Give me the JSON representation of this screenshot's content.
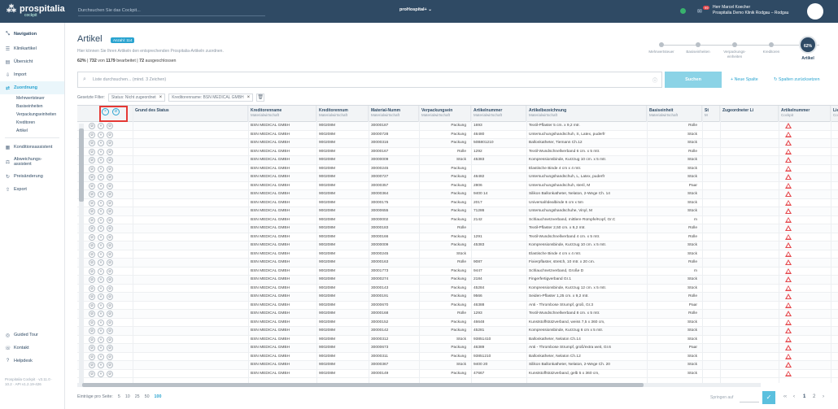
{
  "topbar": {
    "logo": "prospitalia",
    "logo_sub": "cockpit",
    "search_placeholder": "Durchsuchen Sie das Cockpit...",
    "tenant": "proHospital+ ⌄",
    "badge": "99",
    "user_name": "Herr Marcel Koecher",
    "user_org": "Prospitalia Demo Klinik Rodgau – Rodgau"
  },
  "sidebar": {
    "header": "Navigation",
    "items": [
      {
        "label": "Klinikartikel"
      },
      {
        "label": "Übersicht"
      },
      {
        "label": "Import"
      },
      {
        "label": "Zuordnung"
      }
    ],
    "subitems": [
      "Mehrwertsteuer",
      "Basiseinheiten",
      "Verpackungseinheiten",
      "Kreditoren",
      "Artikel"
    ],
    "items2": [
      {
        "label": "Konditionsassistent"
      },
      {
        "label": "Abweichungs-assistent"
      },
      {
        "label": "Preisänderung"
      },
      {
        "label": "Export"
      }
    ],
    "bottom": [
      {
        "label": "Guided Tour"
      },
      {
        "label": "Kontakt"
      },
      {
        "label": "Helpdesk"
      }
    ],
    "version": "Prospitalia Cockpit · v3.11.0 · 10.2 · API v1.2.19-426"
  },
  "page": {
    "title": "Artikel",
    "count_badge": "Anzahl: 114",
    "description": "Hier können Sie Ihren Artikeln den entsprechenden Prospitalia-Artikeln zuordnen.",
    "progress_pct": "62%",
    "progress_a": "732",
    "progress_mid": " von ",
    "progress_b": "1179",
    "progress_tail": " bearbeitet | ",
    "progress_c": "72",
    "progress_tail2": " ausgeschlossen"
  },
  "steps": {
    "items": [
      "Mehrwertsteuer",
      "Basiseinheiten",
      "Verpackungs-einheiten",
      "Kreditoren",
      "Artikel"
    ],
    "current_pct": "62%"
  },
  "search": {
    "placeholder": "Liste durchsuchen... (mind. 3 Zeichen)",
    "button": "Suchen",
    "new_column": "+ Neue Spalte",
    "reset_columns": "Spalten zurücksetzen"
  },
  "filters": {
    "label": "Gesetzte Filter:",
    "chips": [
      "Status: Nicht zugeordnet",
      "Kreditorenname: BSN MEDICAL GMBH"
    ]
  },
  "columns": [
    {
      "title": "Grund des Status",
      "sub": ""
    },
    {
      "title": "Kreditorenname",
      "sub": "Materialwirtschaft"
    },
    {
      "title": "Kreditorennum",
      "sub": "Materialwirtschaft"
    },
    {
      "title": "Material-Numm",
      "sub": "Materialwirtschaft"
    },
    {
      "title": "Verpackungsein",
      "sub": "Materialwirtschaft"
    },
    {
      "title": "Artikelnummer",
      "sub": "Materialwirtschaft"
    },
    {
      "title": "Artikelbezeichnung",
      "sub": "Materialwirtschaft"
    },
    {
      "title": "Basiseinheit",
      "sub": "Materialwirtschaft"
    },
    {
      "title": "St",
      "sub": "M"
    },
    {
      "title": "Zugeordneter Li",
      "sub": ""
    },
    {
      "title": "Artikelnummer",
      "sub": "Cockpit"
    },
    {
      "title": "Lief",
      "sub": "Cockp"
    }
  ],
  "rows": [
    [
      "BSN MEDICAL GMBH",
      "900208M",
      "30000187",
      "Packung",
      "1693",
      "Textil-Pflaster 5 cm. x 9,2 mtr.",
      "Rolle"
    ],
    [
      "BSN MEDICAL GMBH",
      "900208M",
      "30000728",
      "Packung",
      "46480",
      "Untersuchungshandschuh, S, Latex, puderfr",
      "Stück"
    ],
    [
      "BSN MEDICAL GMBH",
      "900208M",
      "30000316",
      "Packung",
      "50B801210",
      "Ballonkatheter, Tiemann Ch.12",
      "Stück"
    ],
    [
      "BSN MEDICAL GMBH",
      "900208M",
      "30000167",
      "Rolle",
      "1292",
      "Textil-Wundschnellverband 6 cm. x 5 mtr.",
      "Rolle"
    ],
    [
      "BSN MEDICAL GMBH",
      "900208M",
      "30000009",
      "Stück",
      "45383",
      "Kompressionsbinde, Kurzzug 10 cm. x 5 mtr.",
      "Stück"
    ],
    [
      "BSN MEDICAL GMBH",
      "900208M",
      "30000245",
      "Packung",
      "",
      "Elastische Binde 4 cm x 4 mtr.",
      "Stück"
    ],
    [
      "BSN MEDICAL GMBH",
      "900208M",
      "30000727",
      "Packung",
      "46482",
      "Untersuchungshandschuh, L, Latex, puderfr",
      "Stück"
    ],
    [
      "BSN MEDICAL GMBH",
      "900208M",
      "30000357",
      "Packung",
      "2806",
      "Untersuchungshandschuh, steril, M",
      "Paar"
    ],
    [
      "BSN MEDICAL GMBH",
      "900208M",
      "30000364",
      "Packung",
      "9400 14",
      "Silikon Ballonkatheter, Nelaton, 2-Wege Ch. 14",
      "Stück"
    ],
    [
      "BSN MEDICAL GMBH",
      "900208M",
      "30000175",
      "Packung",
      "2017",
      "Universal/Idealbinde 6 cm x 5m",
      "Stück"
    ],
    [
      "BSN MEDICAL GMBH",
      "900208M",
      "30000655",
      "Packung",
      "71286",
      "Untersuchungshandschuhe, Vinyl, M",
      "Stück"
    ],
    [
      "BSN MEDICAL GMBH",
      "900208M",
      "30000002",
      "Packung",
      "2142",
      "Schlauchnetzverband, mittlere Rümpfe/Kopf, Gr.C",
      "m"
    ],
    [
      "BSN MEDICAL GMBH",
      "900208M",
      "30000183",
      "Rolle",
      "",
      "Textil-Pflaster 2,50 cm. x 9,2 mtr.",
      "Rolle"
    ],
    [
      "BSN MEDICAL GMBH",
      "900208M",
      "30000166",
      "Packung",
      "1291",
      "Textil-Wundschnellverband 4 cm. x 5 mtr.",
      "Rolle"
    ],
    [
      "BSN MEDICAL GMBH",
      "900208M",
      "30000009",
      "Packung",
      "45383",
      "Kompressionsbinde, Kurzzug 10 cm. x 5 mtr.",
      "Stück"
    ],
    [
      "BSN MEDICAL GMBH",
      "900208M",
      "30000245",
      "Stück",
      "",
      "Elastische Binde 4 cm x 4 mtr.",
      "Stück"
    ],
    [
      "BSN MEDICAL GMBH",
      "900208M",
      "30000163",
      "Rolle",
      "9087",
      "Fixierpflaster, stretch, 10 mtr. x 20 cm.",
      "Rolle"
    ],
    [
      "BSN MEDICAL GMBH",
      "900208M",
      "30001773",
      "Packung",
      "9447",
      "Schlauchnetzverband, Große D",
      "m"
    ],
    [
      "BSN MEDICAL GMBH",
      "900208M",
      "30000274",
      "Packung",
      "2184",
      "Fingerfertigverband Gr.1",
      "Stück"
    ],
    [
      "BSN MEDICAL GMBH",
      "900208M",
      "30000143",
      "Packung",
      "45284",
      "Kompressionsbinde, Kurzzug 12 cm. x 5 mtr.",
      "Stück"
    ],
    [
      "BSN MEDICAL GMBH",
      "900208M",
      "30000191",
      "Packung",
      "9566",
      "Seiden-Pflaster 1,25 cm. x 9,2 mtr.",
      "Rolle"
    ],
    [
      "BSN MEDICAL GMBH",
      "900208M",
      "30000670",
      "Packung",
      "46388",
      "Anti - Thrombose Strumpf, groß, Gr.3",
      "Paar"
    ],
    [
      "BSN MEDICAL GMBH",
      "900208M",
      "30000168",
      "Rolle",
      "1293",
      "Textil-Wundschnellverband 8 cm. x 5 mtr.",
      "Rolle"
    ],
    [
      "BSN MEDICAL GMBH",
      "900208M",
      "30000152",
      "Packung",
      "46648",
      "Kunststoffstützverband, weiss 7,5 x 360 cm,",
      "Stück"
    ],
    [
      "BSN MEDICAL GMBH",
      "900208M",
      "30000142",
      "Packung",
      "45281",
      "Kompressionsbinde, Kurzzug 6 cm x 5 mtr.",
      "Stück"
    ],
    [
      "BSN MEDICAL GMBH",
      "900208M",
      "30000312",
      "Stück",
      "93851410",
      "Ballonkatheter, Nelaton Ch.14",
      "Stück"
    ],
    [
      "BSN MEDICAL GMBH",
      "900208M",
      "30000673",
      "Packung",
      "46389",
      "Anti - Thrombose Strumpf, groß/extra weit, Gr.6",
      "Paar"
    ],
    [
      "BSN MEDICAL GMBH",
      "900208M",
      "30000311",
      "Packung",
      "93851210",
      "Ballonkatheter, Nelaton Ch.12",
      "Stück"
    ],
    [
      "BSN MEDICAL GMBH",
      "900208M",
      "30000367",
      "Stück",
      "9400 20",
      "Silikon Ballonkatheter, Nelaton, 2-Wege Ch. 20",
      "Stück"
    ],
    [
      "BSN MEDICAL GMBH",
      "900208M",
      "30000149",
      "Packung",
      "47667",
      "Kunststoffstützverband, gelb 5 x 360 cm,",
      "Stück"
    ]
  ],
  "pager": {
    "label": "Einträge pro Seite:",
    "options": [
      "5",
      "10",
      "25",
      "50",
      "100"
    ],
    "jump_label": "Springen auf",
    "go": "✓",
    "prev": "‹",
    "first": "‹‹",
    "page1": "1",
    "page2": "2",
    "next": "›"
  }
}
